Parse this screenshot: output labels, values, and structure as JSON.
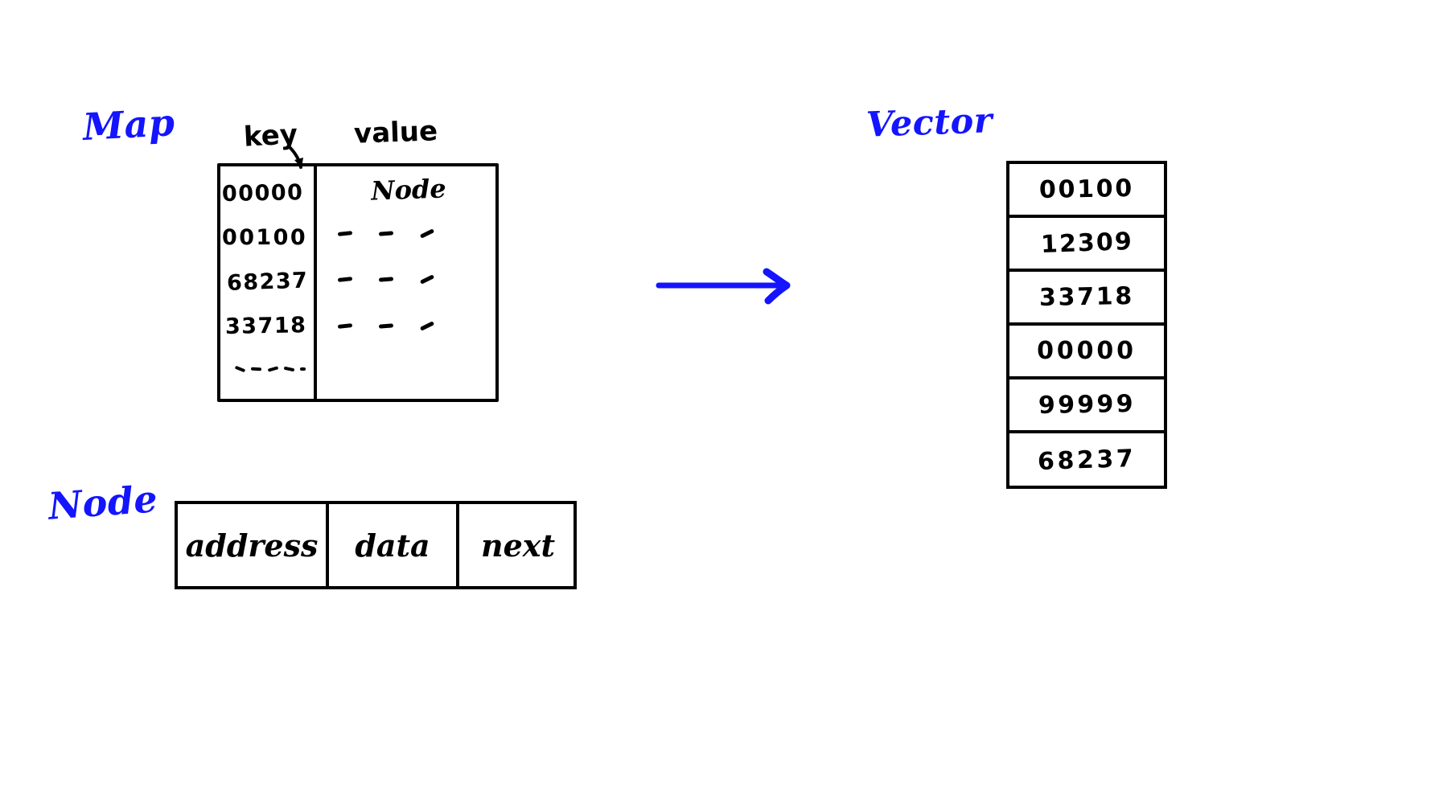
{
  "page": {
    "background_color": "#ffffff",
    "ink_color": "#000000",
    "accent_color": "#1414ff",
    "style": "hand-drawn whiteboard sketch"
  },
  "map": {
    "title": "Map",
    "headers": {
      "key": "key",
      "value": "value"
    },
    "rows": [
      {
        "key": "00000",
        "value": "Node"
      },
      {
        "key": "00100",
        "value": "- - -"
      },
      {
        "key": "68237",
        "value": "- - -"
      },
      {
        "key": "33718",
        "value": "- - -"
      },
      {
        "key": "- - - - -",
        "value": ""
      }
    ]
  },
  "arrow": {
    "icon": "right-arrow-icon",
    "direction": "right",
    "color": "#1414ff"
  },
  "vector": {
    "title": "Vector",
    "cells": [
      "00100",
      "12309",
      "33718",
      "00000",
      "99999",
      "68237"
    ]
  },
  "node": {
    "title": "Node",
    "fields": [
      "address",
      "data",
      "next"
    ]
  }
}
